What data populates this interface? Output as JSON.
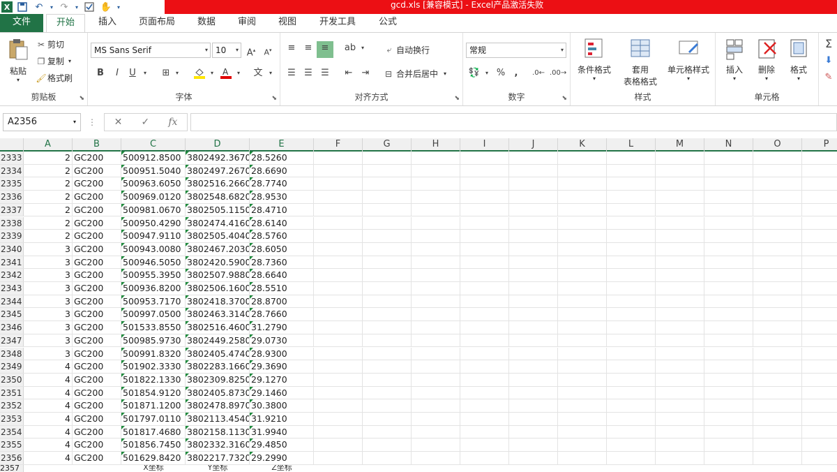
{
  "titlebar": {
    "title": "gcd.xls  [兼容模式] - Excel产品激活失败",
    "qat": [
      "X",
      "save-icon",
      "undo-icon",
      "redo-icon",
      "check-icon",
      "touch-icon"
    ],
    "accent": "#ec0f14"
  },
  "tabs": [
    "文件",
    "开始",
    "插入",
    "页面布局",
    "数据",
    "审阅",
    "视图",
    "开发工具",
    "公式"
  ],
  "ribbon": {
    "clipboard": {
      "paste": "粘贴",
      "cut": "剪切",
      "copy": "复制",
      "format_painter": "格式刷",
      "label": "剪贴板"
    },
    "font": {
      "name": "MS Sans Serif",
      "size": "10",
      "grow": "A",
      "shrink": "A",
      "bold": "B",
      "italic": "I",
      "underline": "U",
      "phonetic": "文",
      "label": "字体"
    },
    "alignment": {
      "wrap": "自动换行",
      "merge": "合并后居中",
      "label": "对齐方式"
    },
    "number": {
      "format": "常规",
      "percent": "%",
      "comma": ",",
      "label": "数字"
    },
    "styles": {
      "conditional": "条件格式",
      "table": "套用",
      "table2": "表格格式",
      "cell_styles": "单元格样式",
      "label": "样式"
    },
    "cells": {
      "insert": "插入",
      "delete": "删除",
      "format": "格式",
      "label": "单元格"
    }
  },
  "formula_bar": {
    "name_box": "A2356",
    "fx": "fx",
    "cancel": "✕",
    "enter": "✓"
  },
  "columns": [
    "A",
    "B",
    "C",
    "D",
    "E",
    "F",
    "G",
    "H",
    "I",
    "J",
    "K",
    "L",
    "M",
    "N",
    "O",
    "P"
  ],
  "rows": [
    {
      "n": "2333",
      "a": "2",
      "b": "GC200",
      "c": "500912.8500",
      "d": "3802492.3670",
      "e": "28.5260"
    },
    {
      "n": "2334",
      "a": "2",
      "b": "GC200",
      "c": "500951.5040",
      "d": "3802497.2670",
      "e": "28.6690"
    },
    {
      "n": "2335",
      "a": "2",
      "b": "GC200",
      "c": "500963.6050",
      "d": "3802516.2660",
      "e": "28.7740"
    },
    {
      "n": "2336",
      "a": "2",
      "b": "GC200",
      "c": "500969.0120",
      "d": "3802548.6820",
      "e": "28.9530"
    },
    {
      "n": "2337",
      "a": "2",
      "b": "GC200",
      "c": "500981.0670",
      "d": "3802505.1150",
      "e": "28.4710"
    },
    {
      "n": "2338",
      "a": "2",
      "b": "GC200",
      "c": "500950.4290",
      "d": "3802474.4160",
      "e": "28.6140"
    },
    {
      "n": "2339",
      "a": "2",
      "b": "GC200",
      "c": "500947.9110",
      "d": "3802505.4040",
      "e": "28.5760"
    },
    {
      "n": "2340",
      "a": "3",
      "b": "GC200",
      "c": "500943.0080",
      "d": "3802467.2030",
      "e": "28.6050"
    },
    {
      "n": "2341",
      "a": "3",
      "b": "GC200",
      "c": "500946.5050",
      "d": "3802420.5900",
      "e": "28.7360"
    },
    {
      "n": "2342",
      "a": "3",
      "b": "GC200",
      "c": "500955.3950",
      "d": "3802507.9880",
      "e": "28.6640"
    },
    {
      "n": "2343",
      "a": "3",
      "b": "GC200",
      "c": "500936.8200",
      "d": "3802506.1600",
      "e": "28.5510"
    },
    {
      "n": "2344",
      "a": "3",
      "b": "GC200",
      "c": "500953.7170",
      "d": "3802418.3700",
      "e": "28.8700"
    },
    {
      "n": "2345",
      "a": "3",
      "b": "GC200",
      "c": "500997.0500",
      "d": "3802463.3140",
      "e": "28.7660"
    },
    {
      "n": "2346",
      "a": "3",
      "b": "GC200",
      "c": "501533.8550",
      "d": "3802516.4600",
      "e": "31.2790"
    },
    {
      "n": "2347",
      "a": "3",
      "b": "GC200",
      "c": "500985.9730",
      "d": "3802449.2580",
      "e": "29.0730"
    },
    {
      "n": "2348",
      "a": "3",
      "b": "GC200",
      "c": "500991.8320",
      "d": "3802405.4740",
      "e": "28.9300"
    },
    {
      "n": "2349",
      "a": "4",
      "b": "GC200",
      "c": "501902.3330",
      "d": "3802283.1660",
      "e": "29.3690"
    },
    {
      "n": "2350",
      "a": "4",
      "b": "GC200",
      "c": "501822.1330",
      "d": "3802309.8250",
      "e": "29.1270"
    },
    {
      "n": "2351",
      "a": "4",
      "b": "GC200",
      "c": "501854.9120",
      "d": "3802405.8730",
      "e": "29.1460"
    },
    {
      "n": "2352",
      "a": "4",
      "b": "GC200",
      "c": "501871.1200",
      "d": "3802478.8970",
      "e": "30.3800"
    },
    {
      "n": "2353",
      "a": "4",
      "b": "GC200",
      "c": "501797.0110",
      "d": "3802113.4540",
      "e": "31.9210"
    },
    {
      "n": "2354",
      "a": "4",
      "b": "GC200",
      "c": "501817.4680",
      "d": "3802158.1130",
      "e": "31.9940"
    },
    {
      "n": "2355",
      "a": "4",
      "b": "GC200",
      "c": "501856.7450",
      "d": "3802332.3160",
      "e": "29.4850"
    },
    {
      "n": "2356",
      "a": "4",
      "b": "GC200",
      "c": "501629.8420",
      "d": "3802217.7320",
      "e": "29.2990"
    }
  ],
  "last_row": {
    "n": "2357",
    "c": "X坐标",
    "d": "Y坐标",
    "e": "Z坐标"
  }
}
